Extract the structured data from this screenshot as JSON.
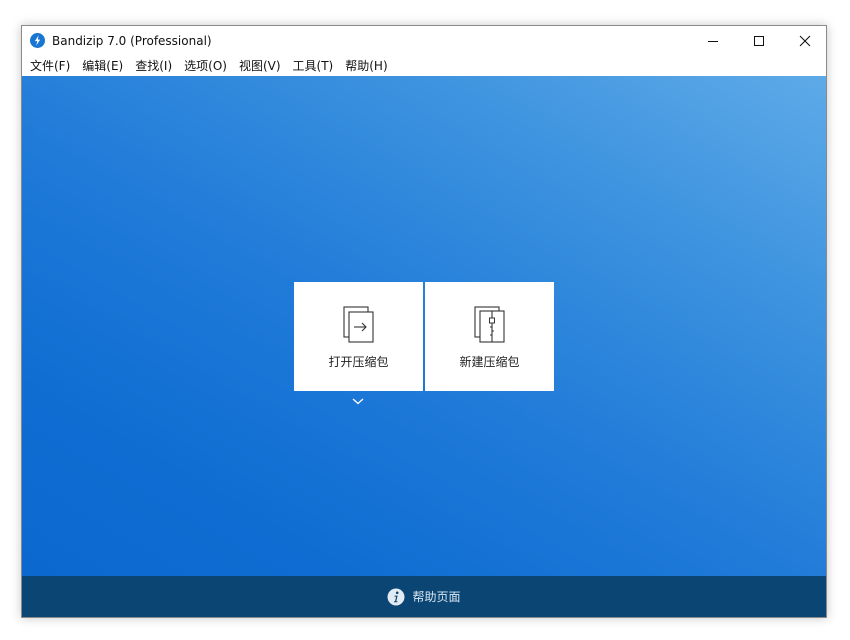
{
  "window": {
    "title": "Bandizip 7.0 (Professional)"
  },
  "menu": {
    "items": [
      "文件(F)",
      "编辑(E)",
      "查找(I)",
      "选项(O)",
      "视图(V)",
      "工具(T)",
      "帮助(H)"
    ]
  },
  "main": {
    "open_archive_label": "打开压缩包",
    "new_archive_label": "新建压缩包"
  },
  "footer": {
    "help_label": "帮助页面"
  },
  "icons": {
    "app": "bandizip-logo-icon",
    "minimize": "minimize-icon",
    "maximize": "maximize-icon",
    "close": "close-icon",
    "open": "open-archive-icon",
    "new": "new-archive-icon",
    "dropdown": "chevron-down-icon",
    "help": "info-icon"
  },
  "colors": {
    "accent": "#1f7ad8",
    "footer": "#0a4573"
  }
}
